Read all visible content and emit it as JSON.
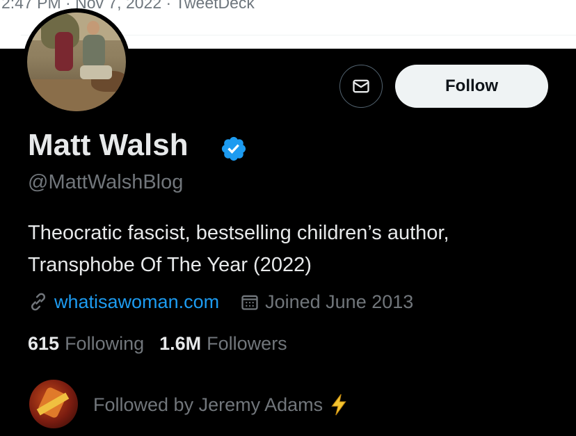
{
  "previous_tweet": {
    "meta": "2:47 PM · Nov 7, 2022 · TweetDeck"
  },
  "profile": {
    "name": "Matt Walsh",
    "handle": "@MattWalshBlog",
    "verified_icon": "verified-badge-icon",
    "bio_lines": [
      "Theocratic fascist, bestselling children’s author,",
      "Transphobe Of The Year (2022)"
    ],
    "website": "whatisawoman.com",
    "joined": "Joined June 2013",
    "following_count": "615",
    "following_label": "Following",
    "followers_count": "1.6M",
    "followers_label": "Followers",
    "followed_by": "Followed by Jeremy Adams"
  },
  "actions": {
    "message_icon": "envelope-icon",
    "follow_label": "Follow"
  },
  "colors": {
    "background": "#000000",
    "primary_text": "#e7e9ea",
    "secondary_text": "#71767b",
    "link": "#1d9bf0",
    "verified": "#1d9bf0",
    "follow_button_bg": "#eff3f4"
  }
}
